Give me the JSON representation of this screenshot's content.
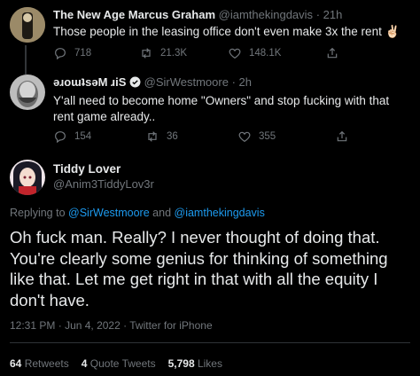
{
  "tweets": [
    {
      "display_name": "The New Age Marcus Graham",
      "handle": "@iamthekingdavis",
      "separator": "·",
      "time": "21h",
      "text": "Those people in the leasing office don't even make 3x the rent ✌🏻",
      "replies": "718",
      "retweets": "21.3K",
      "likes": "148.1K"
    },
    {
      "display_name": "ǝɹoɯʇsǝM ɹiS",
      "handle": "@SirWestmoore",
      "separator": "·",
      "time": "2h",
      "text": "Y'all need to become home \"Owners\" and stop fucking with that rent game already..",
      "replies": "154",
      "retweets": "36",
      "likes": "355"
    }
  ],
  "main": {
    "display_name": "Tiddy Lover",
    "handle": "@Anim3TiddyLov3r",
    "replying_prefix": "Replying to",
    "replying_user1": "@SirWestmoore",
    "replying_and": "and",
    "replying_user2": "@iamthekingdavis",
    "text": "Oh fuck man. Really? I never thought of doing that. You're clearly some genius for thinking of something like that. Let me get right in that with all the equity I don't have.",
    "time": "12:31 PM",
    "date": "Jun 4, 2022",
    "source": "Twitter for iPhone",
    "meta_separator": "·",
    "retweets_count": "64",
    "retweets_label": "Retweets",
    "quotes_count": "4",
    "quotes_label": "Quote Tweets",
    "likes_count": "5,798",
    "likes_label": "Likes"
  },
  "colors": {
    "background": "#000000",
    "text": "#e7e9ea",
    "muted": "#71767b",
    "link": "#1d9bf0",
    "verified": "#1d9bf0"
  }
}
